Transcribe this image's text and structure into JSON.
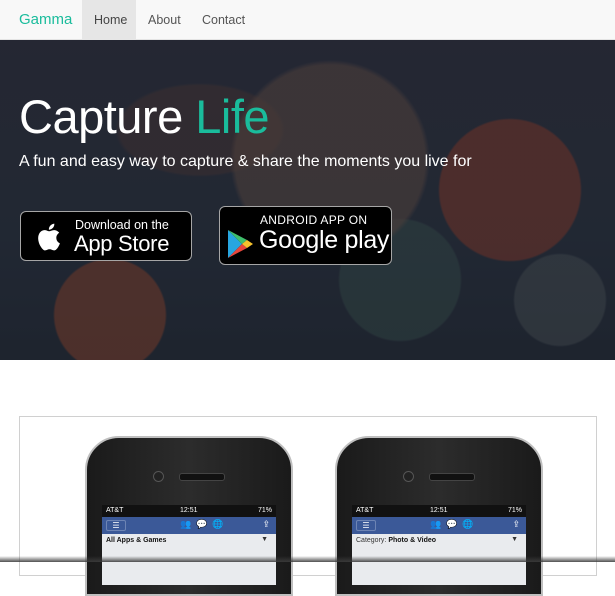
{
  "navbar": {
    "brand": "Gamma",
    "links": [
      {
        "label": "Home",
        "active": true
      },
      {
        "label": "About",
        "active": false
      },
      {
        "label": "Contact",
        "active": false
      }
    ]
  },
  "hero": {
    "title_main": "Capture",
    "title_accent": "Life",
    "subtitle": "A fun and easy way to capture & share the moments you live for",
    "app_store": {
      "small": "Download on the",
      "big": "App Store",
      "icon": "apple-icon"
    },
    "google_play": {
      "small": "ANDROID APP ON",
      "big": "Google play",
      "icon": "google-play-icon"
    }
  },
  "screens": [
    {
      "carrier": "AT&T",
      "time": "12:51",
      "battery": "71%",
      "caption_label": "",
      "caption_value": "All Apps & Games"
    },
    {
      "carrier": "AT&T",
      "time": "12:51",
      "battery": "71%",
      "caption_label": "Category:",
      "caption_value": "Photo & Video"
    }
  ],
  "colors": {
    "accent": "#1abc9c",
    "navbar_bg": "#f8f8f8",
    "facebook_blue": "#3b5998"
  }
}
